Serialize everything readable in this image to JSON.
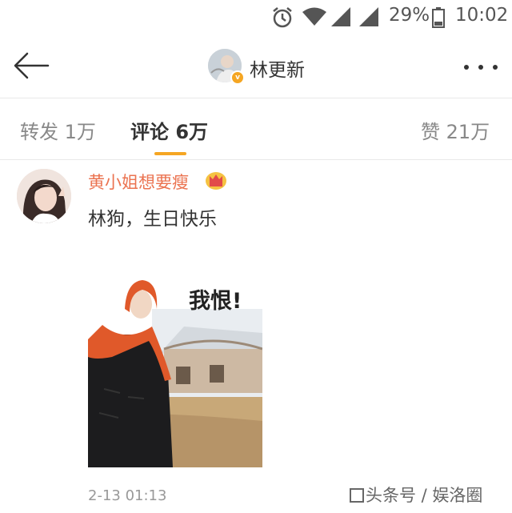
{
  "status_bar": {
    "battery_percent": "29%",
    "time": "10:02",
    "icons": [
      "alarm-icon",
      "wifi-icon",
      "signal-icon",
      "signal-icon",
      "battery-icon"
    ]
  },
  "title_bar": {
    "name": "林更新",
    "verified_badge": "v",
    "icons": [
      "back-arrow-icon",
      "more-icon"
    ]
  },
  "tabs": [
    {
      "label": "转发 1万",
      "active": false
    },
    {
      "label": "评论 6万",
      "active": true
    },
    {
      "label": "赞 21万",
      "active": false
    }
  ],
  "comment": {
    "user_name": "黄小姐想要瘦",
    "text": "林狗，生日快乐",
    "image_caption": "我恨!",
    "time": "2-13 01:13",
    "badge_icon": "crown-icon"
  },
  "watermark": "头条号 / 娱洛圈",
  "colors": {
    "accent": "#f5a623",
    "username": "#eb7350",
    "text": "#333333",
    "muted": "#888888"
  }
}
